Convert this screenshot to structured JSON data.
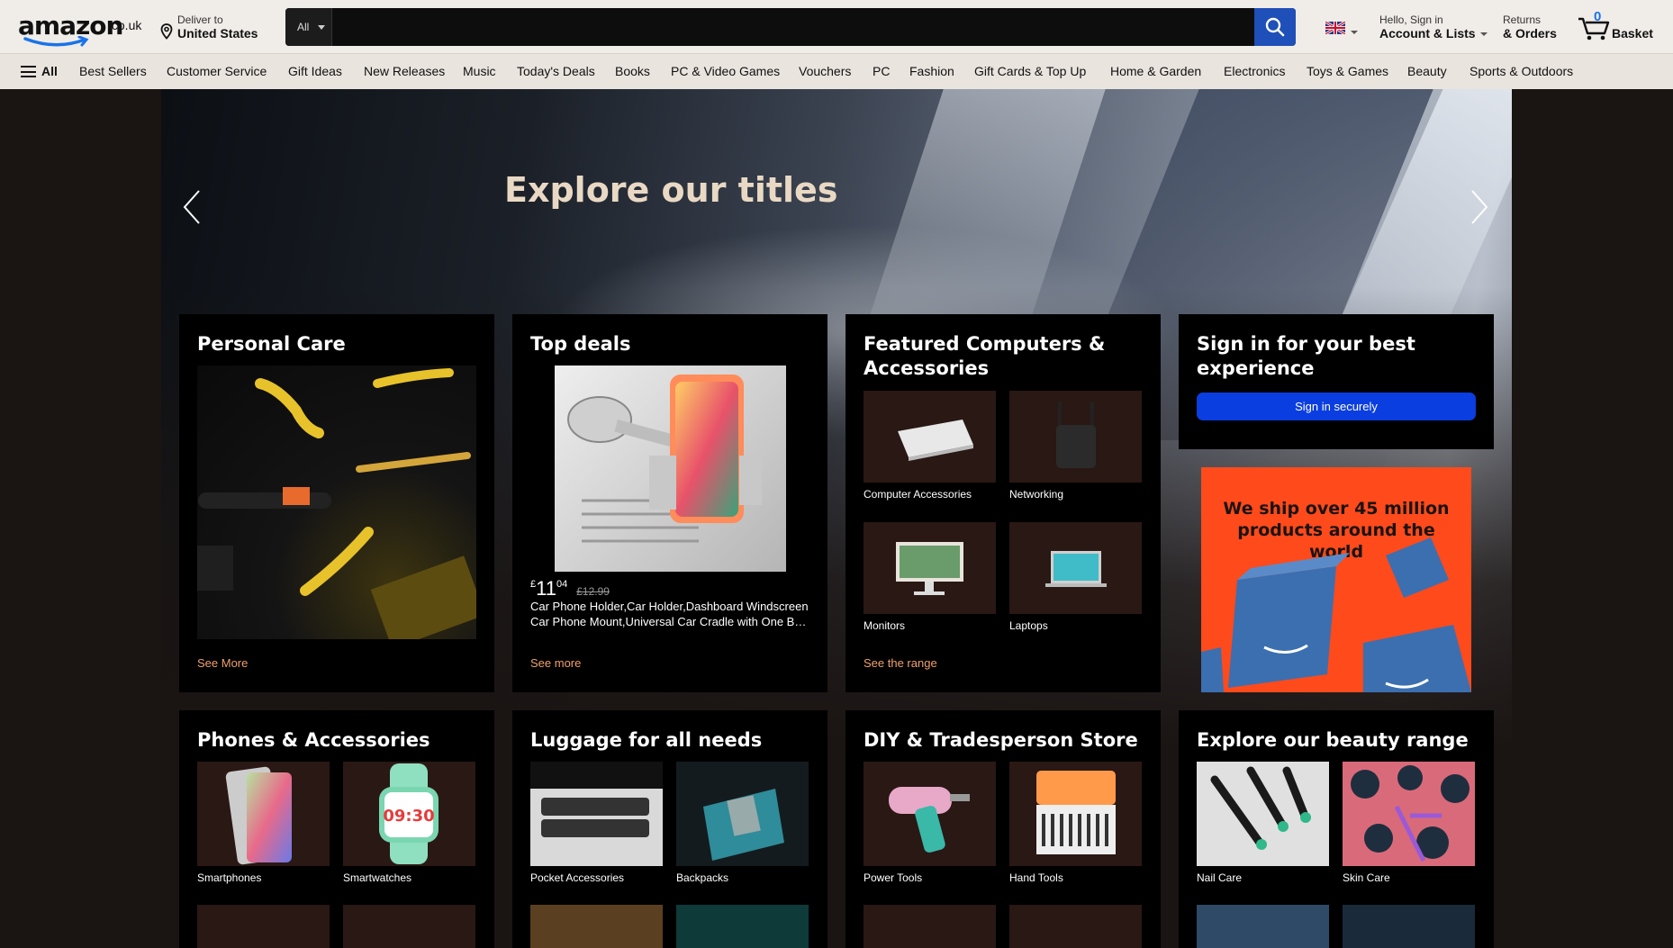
{
  "header": {
    "logo_word": "amazon",
    "logo_tld": ".co.uk",
    "deliver_line1": "Deliver to",
    "deliver_line2": "United States",
    "search_category": "All",
    "search_placeholder": "",
    "account_line1": "Hello, Sign in",
    "account_line2": "Account & Lists",
    "returns_line1": "Returns",
    "returns_line2": "& Orders",
    "basket_count": "0",
    "basket_label": "Basket"
  },
  "nav": {
    "all_label": "All",
    "items": [
      "Best Sellers",
      "Customer Service",
      "Gift Ideas",
      "New Releases",
      "Music",
      "Today's Deals",
      "Books",
      "PC & Video Games",
      "Vouchers",
      "PC",
      "Fashion",
      "Gift Cards & Top Up",
      "Home & Garden",
      "Electronics",
      "Toys & Games",
      "Beauty",
      "Sports & Outdoors"
    ]
  },
  "hero": {
    "title": "Explore our titles"
  },
  "cards": {
    "personal_care": {
      "title": "Personal Care",
      "link": "See More"
    },
    "top_deals": {
      "title": "Top deals",
      "price_currency": "£",
      "price_whole": "11",
      "price_fraction": "04",
      "price_was": "£12.99",
      "desc_line1": "Car Phone Holder,Car Holder,Dashboard Windscreen",
      "desc_line2": "Car Phone Mount,Universal Car Cradle with One B…",
      "link": "See more"
    },
    "computers": {
      "title": "Featured Computers & Accessories",
      "tiles": [
        "Computer Accessories",
        "Networking",
        "Monitors",
        "Laptops"
      ],
      "link": "See the range"
    },
    "signin": {
      "title": "Sign in for your best experience",
      "button": "Sign in securely"
    },
    "ship": {
      "text": "We ship over 45 million products around the world"
    },
    "phones": {
      "title": "Phones & Accessories",
      "tiles": [
        "Smartphones",
        "Smartwatches"
      ]
    },
    "luggage": {
      "title": "Luggage for all needs",
      "tiles": [
        "Pocket Accessories",
        "Backpacks"
      ]
    },
    "diy": {
      "title": "DIY & Tradesperson Store",
      "tiles": [
        "Power Tools",
        "Hand Tools"
      ]
    },
    "beauty": {
      "title": "Explore our beauty range",
      "tiles": [
        "Nail Care",
        "Skin Care"
      ]
    }
  },
  "colors": {
    "header_bg": "#f0ece8",
    "nav_bg": "#e9e4de",
    "search_button": "#1f4fb8",
    "signin_button": "#0a3ee0",
    "link": "#f0a06c",
    "ship_banner": "#ff4a1c"
  }
}
